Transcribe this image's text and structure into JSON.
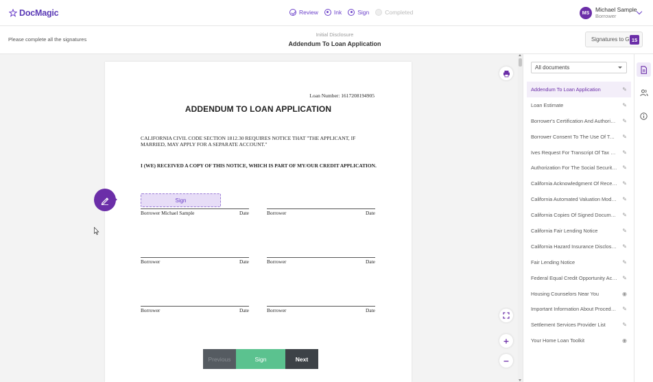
{
  "header": {
    "logo_text": "DocMagic",
    "steps": [
      {
        "label": "Review",
        "state": "done"
      },
      {
        "label": "Ink",
        "state": "active"
      },
      {
        "label": "Sign",
        "state": "active"
      },
      {
        "label": "Completed",
        "state": "pending"
      }
    ],
    "user": {
      "initials": "MS",
      "name": "Michael Sample",
      "role": "Borrower"
    }
  },
  "subheader": {
    "instruction": "Please complete all the signatures",
    "doc_subtitle": "Initial Disclosure",
    "doc_title": "Addendum To Loan Application",
    "signatures_label": "Signatures to Go",
    "signatures_count": "15"
  },
  "document": {
    "loan_number": "Loan Number: 1617208194905",
    "heading": "ADDENDUM TO LOAN APPLICATION",
    "notice": "CALIFORNIA CIVIL CODE SECTION 1812.30 REQUIRES NOTICE THAT \"THE APPLICANT, IF MARRIED, MAY APPLY FOR A SEPARATE ACCOUNT.\"",
    "received": "I (WE) RECEIVED A COPY OF THIS NOTICE, WHICH IS PART OF MY/OUR CREDIT APPLICATION.",
    "sign_box_label": "Sign",
    "signature_blocks": [
      {
        "left": "Borrower Michael Sample",
        "date": "Date"
      },
      {
        "left": "Borrower",
        "date": "Date"
      },
      {
        "left": "Borrower",
        "date": "Date"
      },
      {
        "left": "Borrower",
        "date": "Date"
      },
      {
        "left": "Borrower",
        "date": "Date"
      },
      {
        "left": "Borrower",
        "date": "Date"
      }
    ]
  },
  "navigation": {
    "previous": "Previous",
    "sign": "Sign",
    "next": "Next"
  },
  "sidebar": {
    "filter_value": "All documents",
    "documents": [
      {
        "label": "Addendum To Loan Application",
        "action": "edit",
        "active": true
      },
      {
        "label": "Loan Estimate",
        "action": "edit"
      },
      {
        "label": "Borrower's Certification And Authorizat...",
        "action": "edit"
      },
      {
        "label": "Borrower Consent To The Use Of Tax R...",
        "action": "edit"
      },
      {
        "label": "Ives Request For Transcript Of Tax Ret...",
        "action": "edit"
      },
      {
        "label": "Authorization For The Social Security A...",
        "action": "edit"
      },
      {
        "label": "California Acknowledgment Of Receipt ...",
        "action": "edit"
      },
      {
        "label": "California Automated Valuation Model ...",
        "action": "edit"
      },
      {
        "label": "California Copies Of Signed Documents",
        "action": "edit"
      },
      {
        "label": "California Fair Lending Notice",
        "action": "edit"
      },
      {
        "label": "California Hazard Insurance Disclosure",
        "action": "edit"
      },
      {
        "label": "Fair Lending Notice",
        "action": "edit"
      },
      {
        "label": "Federal Equal Credit Opportunity Act N...",
        "action": "edit"
      },
      {
        "label": "Housing Counselors Near You",
        "action": "view"
      },
      {
        "label": "Important Information About Procedur...",
        "action": "edit"
      },
      {
        "label": "Settlement Services Provider List",
        "action": "edit"
      },
      {
        "label": "Your Home Loan Toolkit",
        "action": "view"
      }
    ]
  },
  "colors": {
    "brand": "#6b2ea8",
    "sign_green": "#5bc28f",
    "nav_dark": "#3d4247"
  }
}
